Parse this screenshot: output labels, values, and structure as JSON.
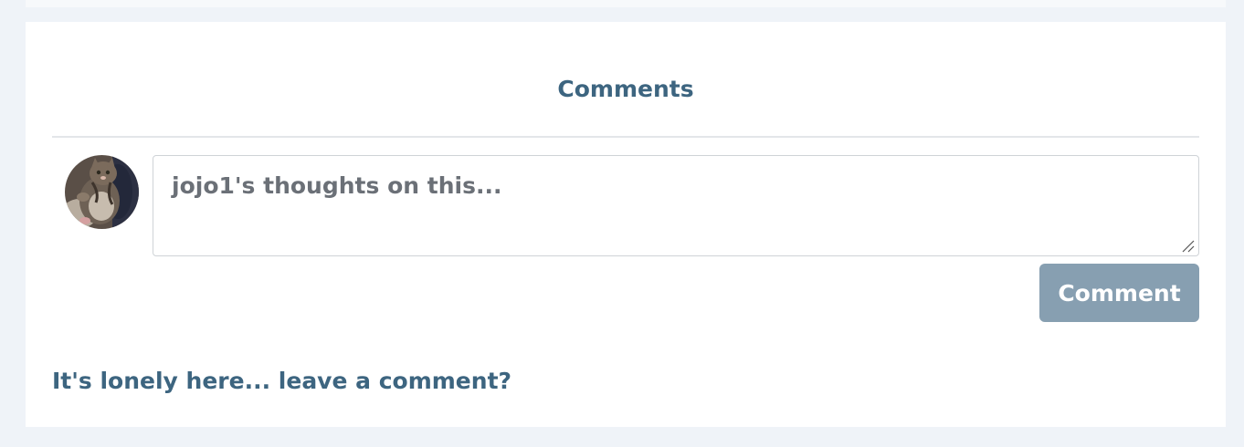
{
  "comments_section": {
    "title": "Comments",
    "input": {
      "placeholder": "jojo1's thoughts on this...",
      "value": ""
    },
    "submit_label": "Comment",
    "empty_message": "It's lonely here... leave a comment?",
    "avatar_icon": "user-avatar-cat-photo"
  },
  "colors": {
    "page_background": "#eff3f8",
    "card_background": "#ffffff",
    "heading": "#3d6580",
    "button_background": "#879fb1",
    "button_text": "#ffffff",
    "placeholder_text": "#6b7077",
    "divider": "#e3e6e9"
  }
}
